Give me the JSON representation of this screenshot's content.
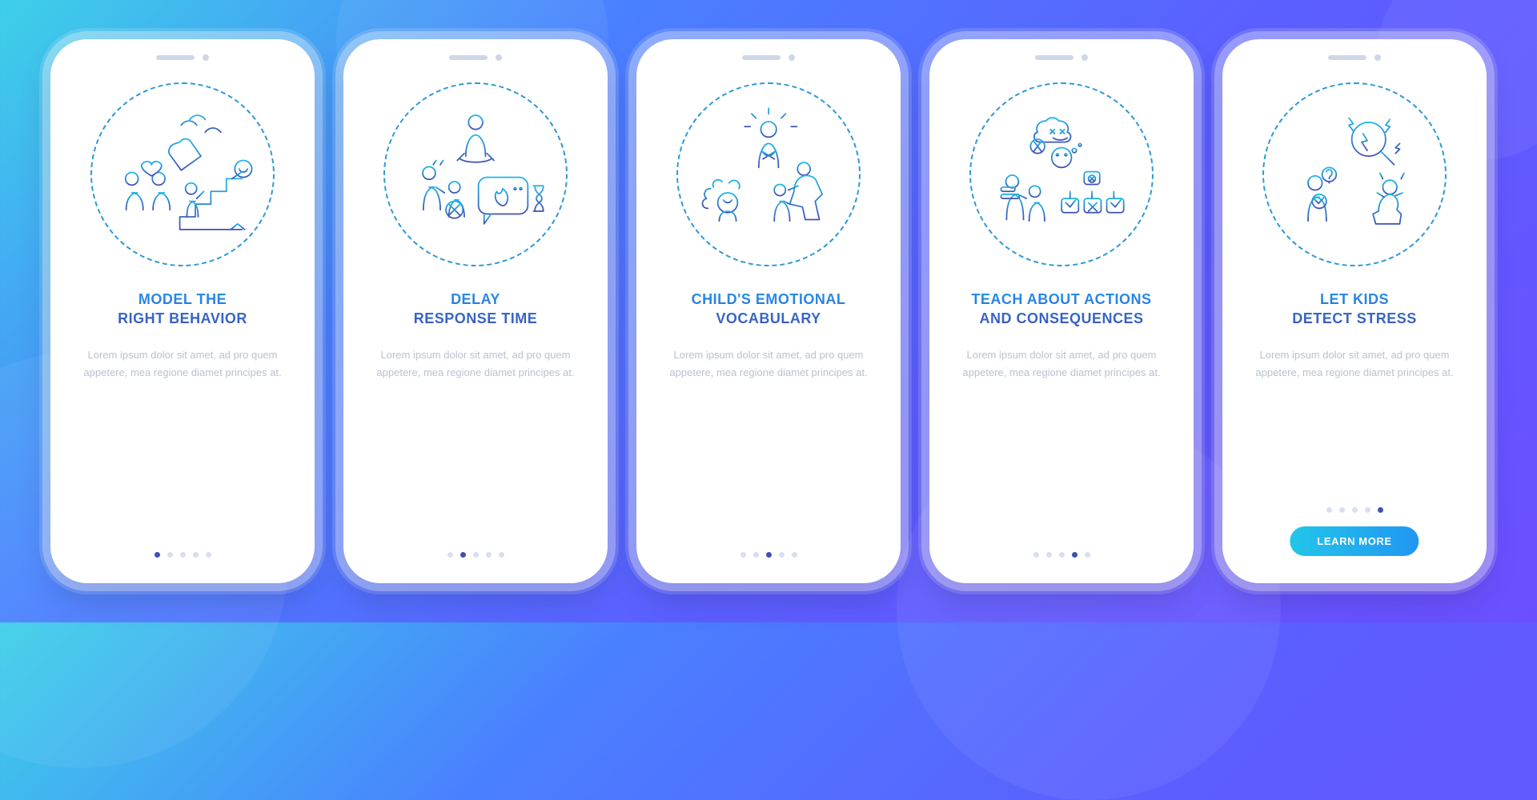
{
  "lorem": "Lorem ipsum dolor sit amet, ad pro quem appetere, mea regione diamet principes at.",
  "cta_label": "LEARN MORE",
  "screens": [
    {
      "title": "MODEL THE\nRIGHT BEHAVIOR",
      "icon": "model-behavior-icon",
      "active_dot": 0,
      "has_cta": false
    },
    {
      "title": "DELAY\nRESPONSE TIME",
      "icon": "delay-response-icon",
      "active_dot": 1,
      "has_cta": false
    },
    {
      "title": "CHILD'S EMOTIONAL\nVOCABULARY",
      "icon": "emotional-vocabulary-icon",
      "active_dot": 2,
      "has_cta": false
    },
    {
      "title": "TEACH ABOUT ACTIONS\nAND CONSEQUENCES",
      "icon": "actions-consequences-icon",
      "active_dot": 3,
      "has_cta": false
    },
    {
      "title": "LET KIDS\nDETECT STRESS",
      "icon": "detect-stress-icon",
      "active_dot": 4,
      "has_cta": true
    }
  ]
}
